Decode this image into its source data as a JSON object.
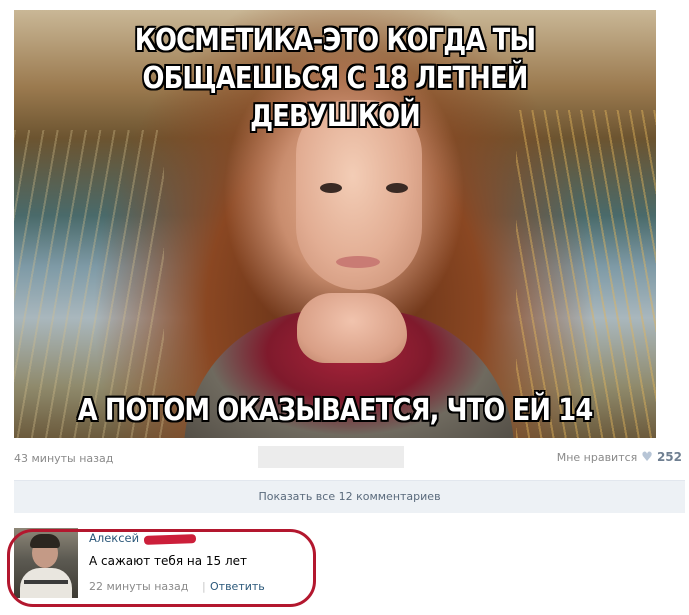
{
  "image": {
    "top_caption": "КОСМЕТИКА-ЭТО КОГДА ТЫ\nОБЩАЕШЬСЯ С 18 ЛЕТНЕЙ ДЕВУШКОЙ",
    "bottom_caption": "А ПОТОМ ОКАЗЫВАЕТСЯ, ЧТО ЕЙ 14"
  },
  "post": {
    "time": "43 минуты назад",
    "like_label": "Мне нравится",
    "like_icon": "heart-icon",
    "like_count": "252"
  },
  "comments_bar": {
    "label": "Показать все 12 комментариев"
  },
  "comment": {
    "author": "Алексей",
    "text": "А сажают тебя на 15 лет",
    "time": "22 минуты назад",
    "separator": "|",
    "reply_label": "Ответить"
  },
  "colors": {
    "link": "#2b587a",
    "muted": "#8a8a8a",
    "bar_bg": "#edf1f5",
    "highlight": "#b3172e"
  }
}
